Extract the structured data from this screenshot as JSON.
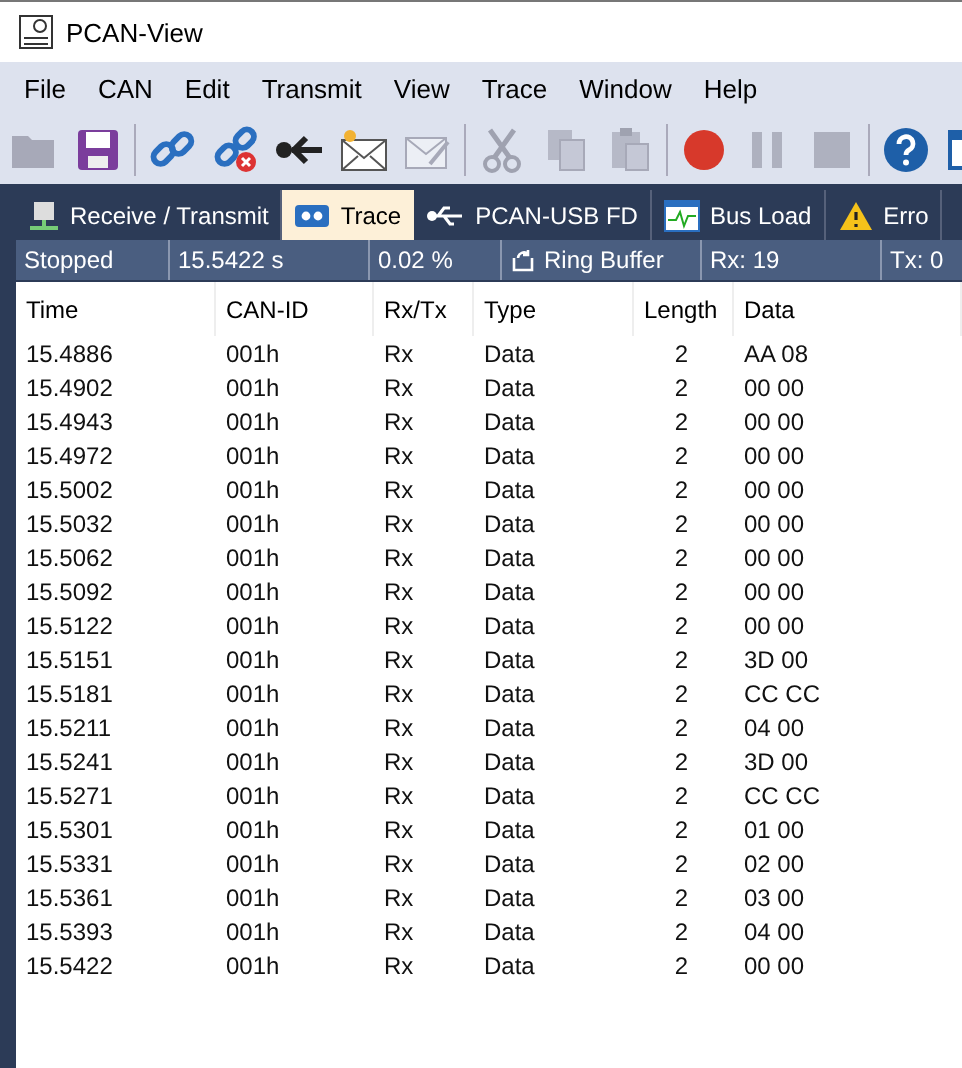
{
  "window": {
    "title": "PCAN-View"
  },
  "menu": [
    "File",
    "CAN",
    "Edit",
    "Transmit",
    "View",
    "Trace",
    "Window",
    "Help"
  ],
  "toolbar": [
    {
      "kind": "open",
      "disabled": true
    },
    {
      "kind": "save",
      "disabled": false
    },
    {
      "kind": "connect",
      "disabled": false
    },
    {
      "kind": "disconnect",
      "disabled": false
    },
    {
      "kind": "plug",
      "disabled": false
    },
    {
      "kind": "new-message",
      "disabled": false
    },
    {
      "kind": "edit-message",
      "disabled": true
    },
    {
      "kind": "cut",
      "disabled": true
    },
    {
      "kind": "copy",
      "disabled": true
    },
    {
      "kind": "paste",
      "disabled": true
    },
    {
      "kind": "record",
      "disabled": false
    },
    {
      "kind": "pause",
      "disabled": true
    },
    {
      "kind": "stop",
      "disabled": true
    },
    {
      "kind": "help",
      "disabled": false
    },
    {
      "kind": "window",
      "disabled": false
    }
  ],
  "tabs": [
    {
      "label": "Receive / Transmit",
      "kind": "network",
      "selected": false
    },
    {
      "label": "Trace",
      "kind": "tape",
      "selected": true
    },
    {
      "label": "PCAN-USB FD",
      "kind": "usb",
      "selected": false
    },
    {
      "label": "Bus Load",
      "kind": "chart",
      "selected": false
    },
    {
      "label": "Erro",
      "kind": "warning",
      "selected": false
    }
  ],
  "status_bar": [
    {
      "text": "Stopped"
    },
    {
      "text": "15.5422 s"
    },
    {
      "text": "0.02 %"
    },
    {
      "text": "Ring Buffer",
      "kind": "ring"
    },
    {
      "text": "Rx: 19"
    },
    {
      "text": "Tx: 0"
    }
  ],
  "table": {
    "columns": [
      "Time",
      "CAN-ID",
      "Rx/Tx",
      "Type",
      "Length",
      "Data"
    ],
    "rows": [
      [
        "15.4886",
        "001h",
        "Rx",
        "Data",
        "2",
        "AA 08"
      ],
      [
        "15.4902",
        "001h",
        "Rx",
        "Data",
        "2",
        "00 00"
      ],
      [
        "15.4943",
        "001h",
        "Rx",
        "Data",
        "2",
        "00 00"
      ],
      [
        "15.4972",
        "001h",
        "Rx",
        "Data",
        "2",
        "00 00"
      ],
      [
        "15.5002",
        "001h",
        "Rx",
        "Data",
        "2",
        "00 00"
      ],
      [
        "15.5032",
        "001h",
        "Rx",
        "Data",
        "2",
        "00 00"
      ],
      [
        "15.5062",
        "001h",
        "Rx",
        "Data",
        "2",
        "00 00"
      ],
      [
        "15.5092",
        "001h",
        "Rx",
        "Data",
        "2",
        "00 00"
      ],
      [
        "15.5122",
        "001h",
        "Rx",
        "Data",
        "2",
        "00 00"
      ],
      [
        "15.5151",
        "001h",
        "Rx",
        "Data",
        "2",
        "3D 00"
      ],
      [
        "15.5181",
        "001h",
        "Rx",
        "Data",
        "2",
        "CC CC"
      ],
      [
        "15.5211",
        "001h",
        "Rx",
        "Data",
        "2",
        "04 00"
      ],
      [
        "15.5241",
        "001h",
        "Rx",
        "Data",
        "2",
        "3D 00"
      ],
      [
        "15.5271",
        "001h",
        "Rx",
        "Data",
        "2",
        "CC CC"
      ],
      [
        "15.5301",
        "001h",
        "Rx",
        "Data",
        "2",
        "01 00"
      ],
      [
        "15.5331",
        "001h",
        "Rx",
        "Data",
        "2",
        "02 00"
      ],
      [
        "15.5361",
        "001h",
        "Rx",
        "Data",
        "2",
        "03 00"
      ],
      [
        "15.5393",
        "001h",
        "Rx",
        "Data",
        "2",
        "04 00"
      ],
      [
        "15.5422",
        "001h",
        "Rx",
        "Data",
        "2",
        "00 00"
      ]
    ]
  }
}
